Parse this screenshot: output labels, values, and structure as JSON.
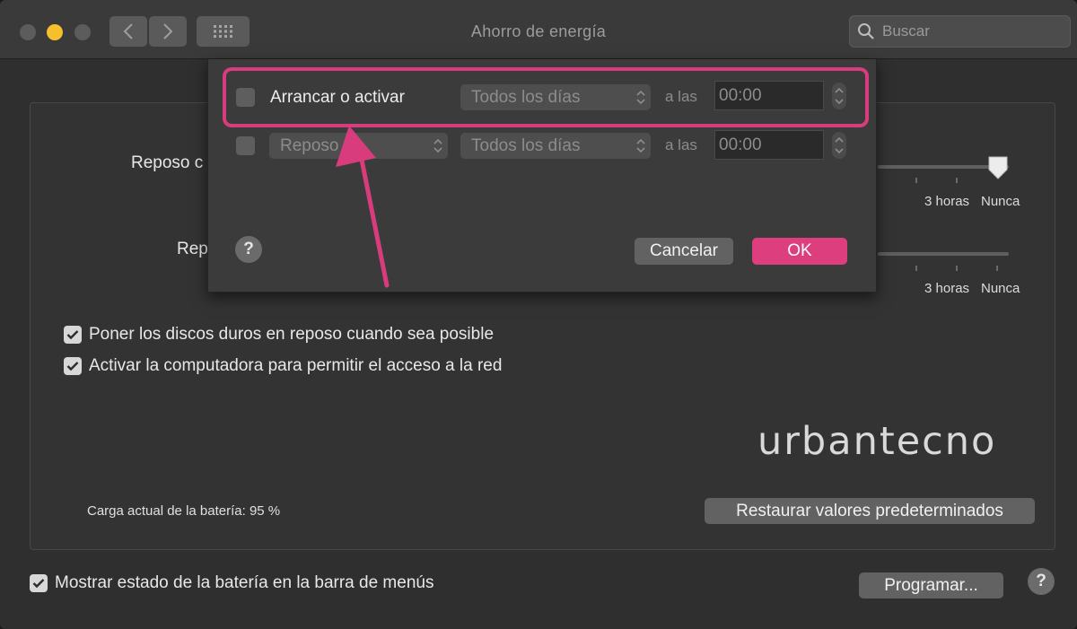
{
  "window": {
    "title": "Ahorro de energía",
    "search_placeholder": "Buscar"
  },
  "sleep_settings": {
    "row1_label_partial": "Reposo c",
    "row2_label_partial": "Rep",
    "tick_labels": [
      "3 horas",
      "Nunca"
    ],
    "computer_sleep_slider_value": "Nunca"
  },
  "options": [
    {
      "label": "Poner los discos duros en reposo cuando sea posible",
      "checked": true
    },
    {
      "label": "Activar la computadora para permitir el acceso a la red",
      "checked": true
    }
  ],
  "brand_watermark": "urbantecno",
  "battery_status": "Carga actual de la batería: 95 %",
  "restore_button": "Restaurar valores predeterminados",
  "menu_bar_option": {
    "label": "Mostrar estado de la batería en la barra de menús",
    "checked": true
  },
  "schedule_button": "Programar...",
  "help_label": "?",
  "schedule_sheet": {
    "row1": {
      "checked": false,
      "label": "Arrancar o activar",
      "days": "Todos los días",
      "at": "a las",
      "time": "00:00"
    },
    "row2": {
      "checked": false,
      "action": "Reposo",
      "days": "Todos los días",
      "at": "a las",
      "time": "00:00"
    },
    "cancel_button": "Cancelar",
    "ok_button": "OK",
    "help_label": "?"
  },
  "colors": {
    "accent_pink": "#d93c7c",
    "ok_button": "#dd3e7d",
    "minimize_yellow": "#f6bf2c"
  }
}
